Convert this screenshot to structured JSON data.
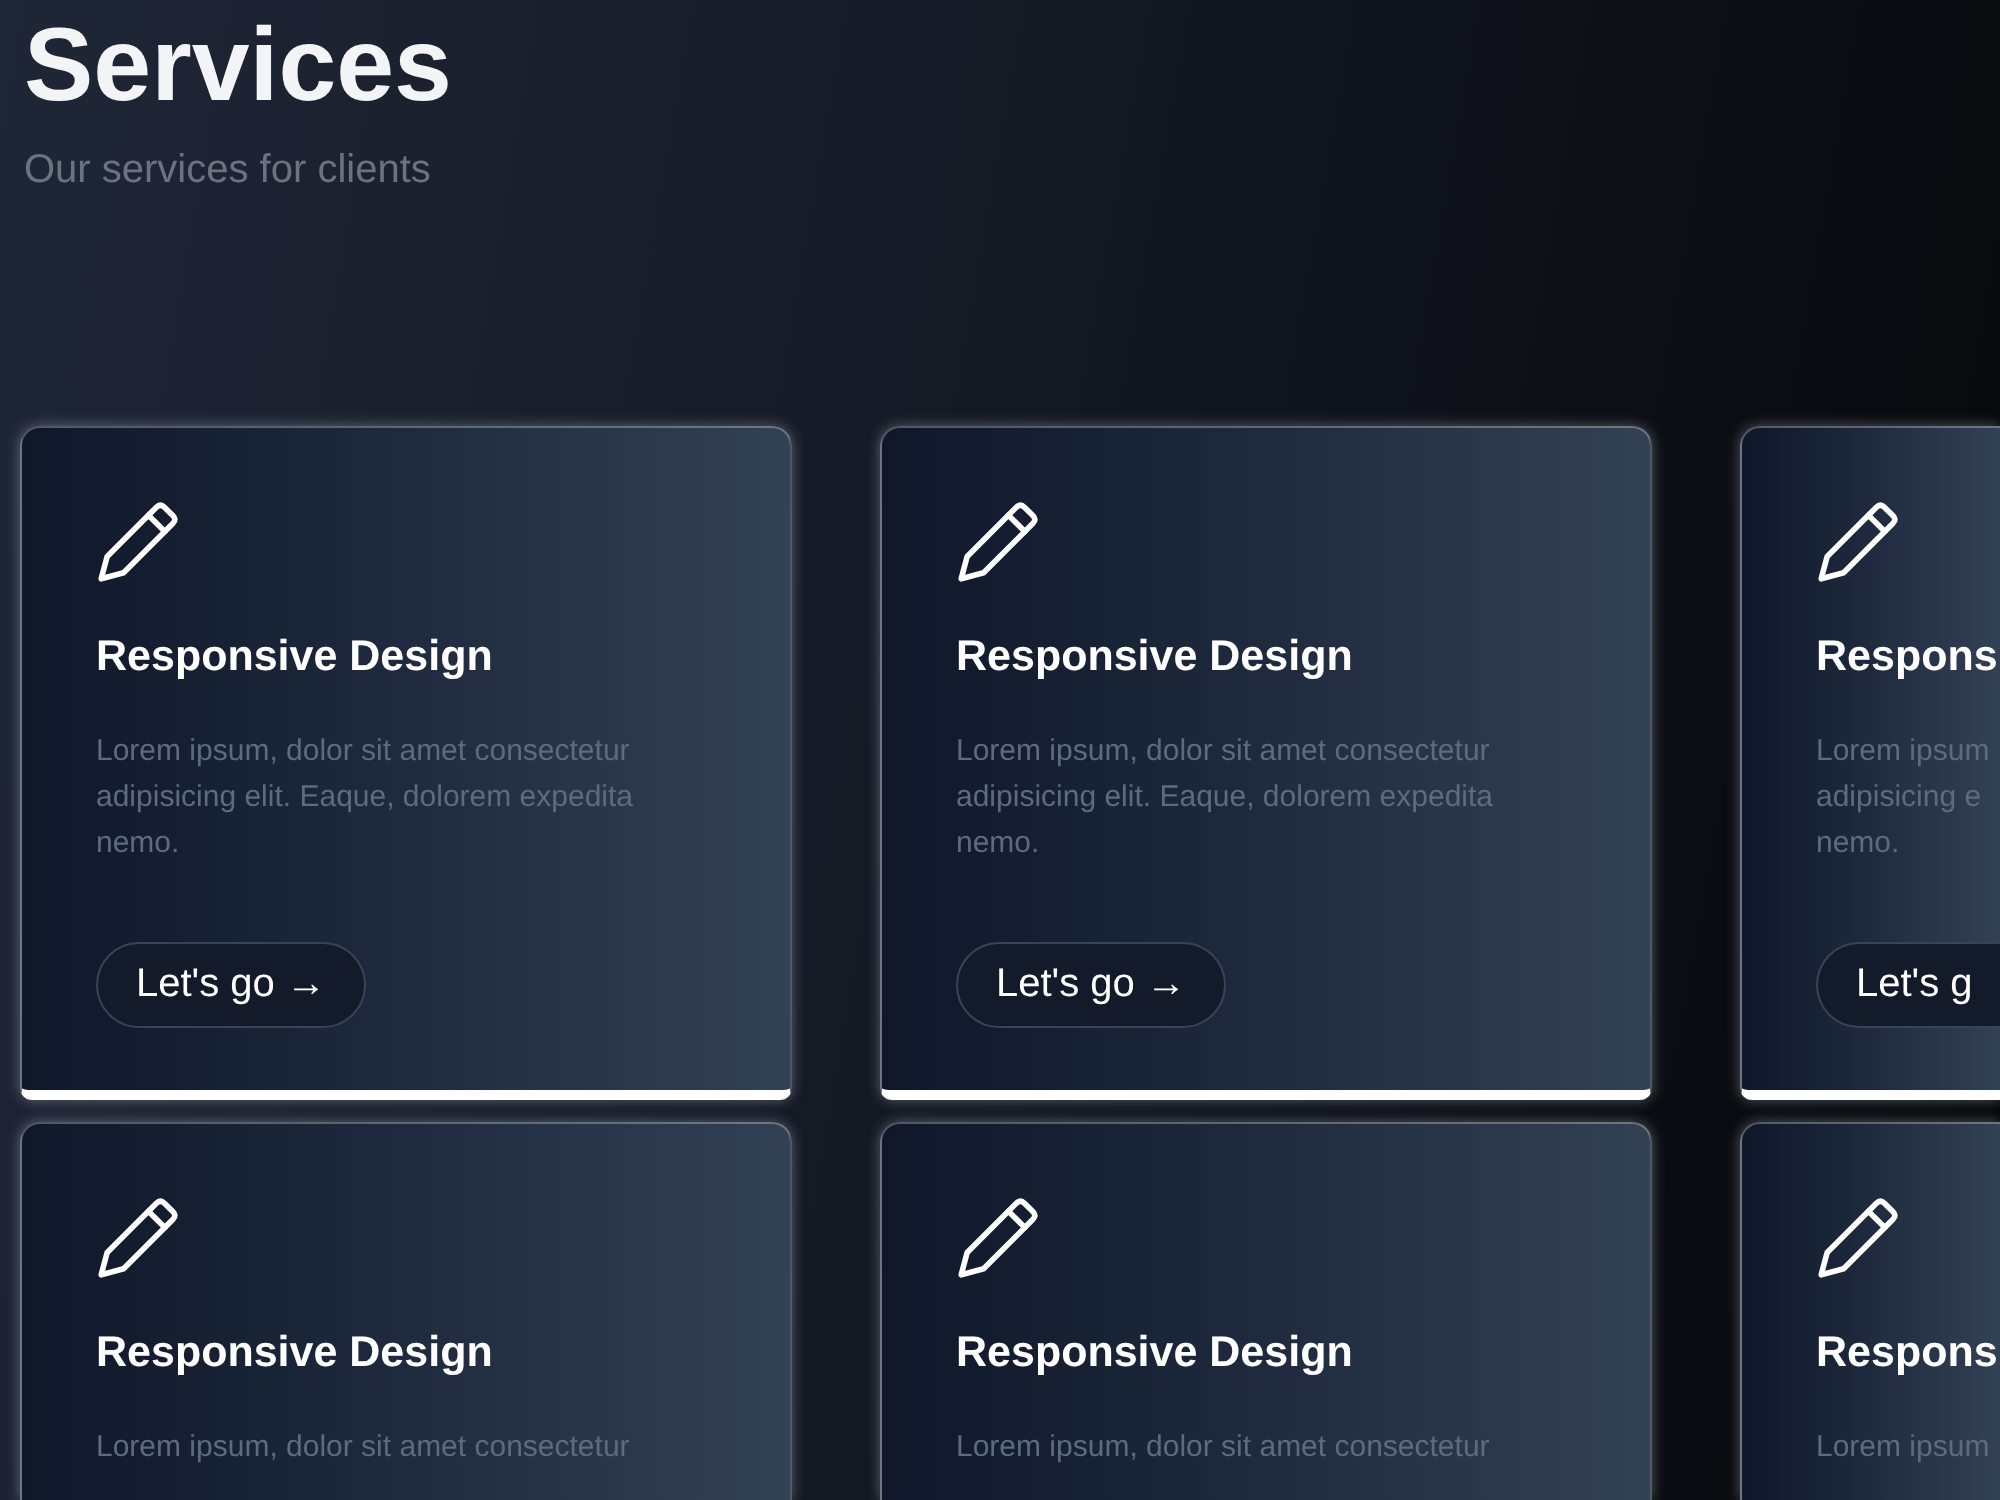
{
  "header": {
    "title": "Services",
    "subtitle": "Our services for clients"
  },
  "cards": [
    {
      "kind": "full",
      "title": "Responsive Design",
      "description": "Lorem ipsum, dolor sit amet consectetur adipisicing elit. Eaque, dolorem expedita nemo.",
      "button": "Let's go →"
    },
    {
      "kind": "full",
      "title": "Responsive Design",
      "description": "Lorem ipsum, dolor sit amet consectetur adipisicing elit. Eaque, dolorem expedita nemo.",
      "button": "Let's go →"
    },
    {
      "kind": "cut-right",
      "title": "Respons",
      "description": "Lorem ipsum adipisicing e nemo.",
      "button": "Let's g"
    },
    {
      "kind": "cut-bottom",
      "title": "Responsive Design",
      "description": "Lorem ipsum, dolor sit amet consectetur"
    },
    {
      "kind": "cut-bottom",
      "title": "Responsive Design",
      "description": "Lorem ipsum, dolor sit amet consectetur"
    },
    {
      "kind": "cut-corner",
      "title": "Respons",
      "description": "Lorem ipsum"
    }
  ]
}
